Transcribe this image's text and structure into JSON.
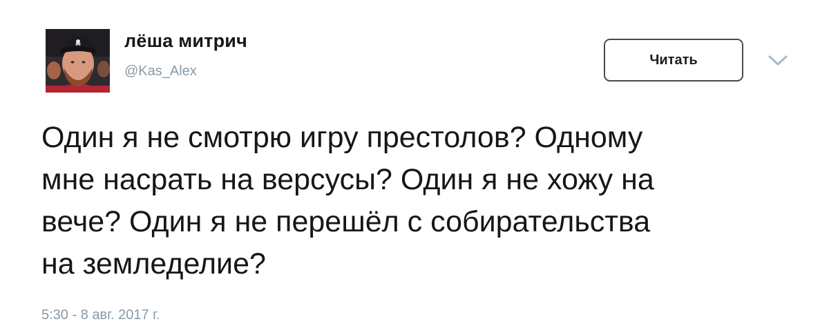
{
  "tweet": {
    "author": {
      "display_name": "лёша митрич",
      "handle": "@Kas_Alex",
      "avatar_icon": "user-avatar-photo"
    },
    "follow_button_label": "Читать",
    "menu_icon": "chevron-down-icon",
    "text_lines": [
      "Один я не смотрю игру престолов? Одному",
      "мне насрать на версусы? Один я не хожу на",
      "вече? Один я не перешёл с собирательства",
      "на земледелие?"
    ],
    "timestamp": "5:30 - 8 авг. 2017 г."
  },
  "colors": {
    "text": "#14171a",
    "muted": "#8899a6",
    "button_border": "#4a4a4a",
    "background": "#ffffff"
  }
}
